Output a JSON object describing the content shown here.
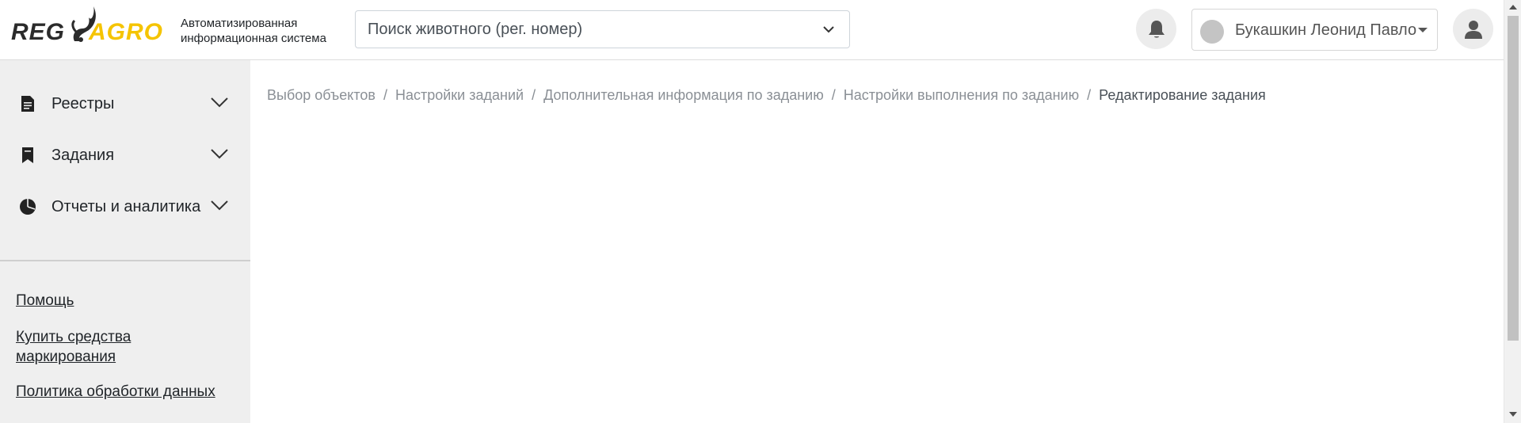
{
  "header": {
    "logo": {
      "left": "REG",
      "right": "AGRO",
      "icon": "bull-head-icon"
    },
    "subtitle_line1": "Автоматизированная",
    "subtitle_line2": "информационная система",
    "search": {
      "placeholder": "Поиск животного (рег. номер)",
      "value": ""
    },
    "user": {
      "name": "Букашкин Леонид Павло"
    }
  },
  "sidebar": {
    "items": [
      {
        "label": "Реестры",
        "icon": "document-icon"
      },
      {
        "label": "Задания",
        "icon": "bookmark-icon"
      },
      {
        "label": "Отчеты и аналитика",
        "icon": "pie-chart-icon"
      }
    ],
    "links": {
      "help": "Помощь",
      "buy_line1": "Купить средства",
      "buy_line2": "маркирования",
      "policy": "Политика обработки данных"
    }
  },
  "breadcrumb": {
    "items": [
      "Выбор объектов",
      "Настройки заданий",
      "Дополнительная информация по заданию",
      "Настройки выполнения по заданию"
    ],
    "current": "Редактирование задания",
    "separator": "/"
  },
  "colors": {
    "accent": "#f5c400",
    "sidebar_bg": "#efefef"
  }
}
